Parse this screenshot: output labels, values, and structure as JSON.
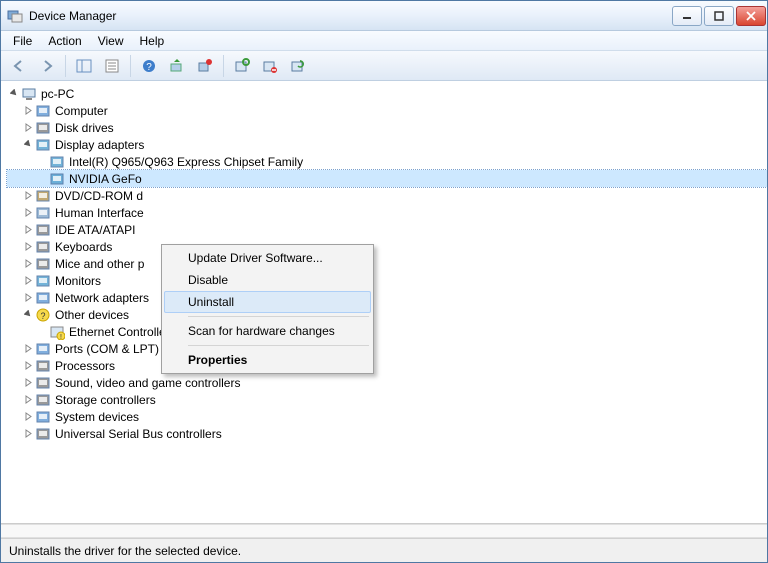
{
  "window": {
    "title": "Device Manager"
  },
  "menubar": {
    "items": [
      "File",
      "Action",
      "View",
      "Help"
    ]
  },
  "toolbar": {
    "back": "back-arrow-icon",
    "forward": "forward-arrow-icon",
    "showhide": "show-hide-tree-icon",
    "console": "console-icon",
    "help": "help-icon",
    "update": "update-driver-icon",
    "prop": "properties-icon",
    "scan": "scan-hardware-icon",
    "uninstall": "uninstall-icon",
    "disable": "disable-icon"
  },
  "tree": {
    "root": {
      "label": "pc-PC",
      "expanded": true
    },
    "nodes": [
      {
        "label": "Computer",
        "expanded": false,
        "icon": "computer"
      },
      {
        "label": "Disk drives",
        "expanded": false,
        "icon": "disk"
      },
      {
        "label": "Display adapters",
        "expanded": true,
        "icon": "display",
        "children": [
          {
            "label": "Intel(R)  Q965/Q963 Express Chipset Family",
            "icon": "display"
          },
          {
            "label": "NVIDIA GeFo",
            "icon": "display",
            "selected": true
          }
        ]
      },
      {
        "label": "DVD/CD-ROM d",
        "expanded": false,
        "icon": "dvd"
      },
      {
        "label": "Human Interface",
        "expanded": false,
        "icon": "hid"
      },
      {
        "label": "IDE ATA/ATAPI",
        "expanded": false,
        "icon": "ide"
      },
      {
        "label": "Keyboards",
        "expanded": false,
        "icon": "keyboard"
      },
      {
        "label": "Mice and other p",
        "expanded": false,
        "icon": "mouse"
      },
      {
        "label": "Monitors",
        "expanded": false,
        "icon": "monitor"
      },
      {
        "label": "Network adapters",
        "expanded": false,
        "icon": "network"
      },
      {
        "label": "Other devices",
        "expanded": true,
        "icon": "other",
        "children": [
          {
            "label": "Ethernet Controller",
            "icon": "warn"
          }
        ]
      },
      {
        "label": "Ports (COM & LPT)",
        "expanded": false,
        "icon": "port"
      },
      {
        "label": "Processors",
        "expanded": false,
        "icon": "cpu"
      },
      {
        "label": "Sound, video and game controllers",
        "expanded": false,
        "icon": "sound"
      },
      {
        "label": "Storage controllers",
        "expanded": false,
        "icon": "storage"
      },
      {
        "label": "System devices",
        "expanded": false,
        "icon": "system"
      },
      {
        "label": "Universal Serial Bus controllers",
        "expanded": false,
        "icon": "usb"
      }
    ]
  },
  "contextMenu": {
    "items": [
      {
        "label": "Update Driver Software..."
      },
      {
        "label": "Disable"
      },
      {
        "label": "Uninstall",
        "highlighted": true
      },
      {
        "sep": true
      },
      {
        "label": "Scan for hardware changes"
      },
      {
        "sep": true
      },
      {
        "label": "Properties",
        "bold": true
      }
    ]
  },
  "statusbar": {
    "text": "Uninstalls the driver for the selected device."
  }
}
